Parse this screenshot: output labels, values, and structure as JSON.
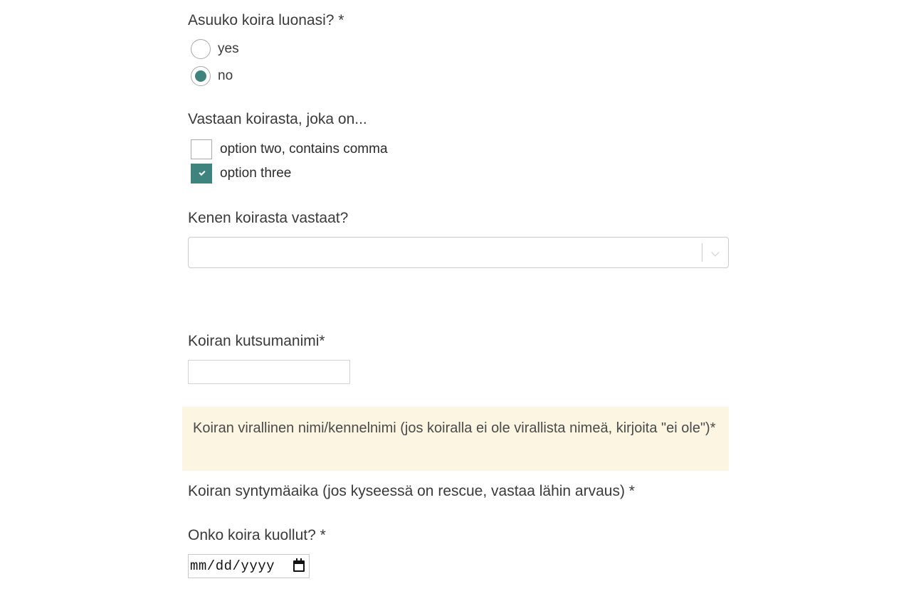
{
  "questions": {
    "lives_with": {
      "label": "Asuuko koira luonasi? *",
      "options": [
        {
          "label": "yes",
          "selected": false
        },
        {
          "label": "no",
          "selected": true
        }
      ]
    },
    "responsible_for": {
      "label": "Vastaan koirasta, joka on...",
      "options": [
        {
          "label": "option two, contains comma",
          "checked": false
        },
        {
          "label": "option three",
          "checked": true
        }
      ]
    },
    "whose_dog": {
      "label": "Kenen koirasta vastaat?",
      "value": ""
    },
    "call_name": {
      "label": "Koiran kutsumanimi*",
      "value": ""
    },
    "official_name": {
      "label": "Koiran virallinen nimi/kennelnimi (jos koiralla ei ole virallista nimeä, kirjoita \"ei ole\")*"
    },
    "birth_date": {
      "label": "Koiran syntymäaika (jos kyseessä on rescue, vastaa lähin arvaus) *"
    },
    "deceased": {
      "label": "Onko koira kuollut? *",
      "date_placeholder": "mm/dd/yyyy"
    }
  },
  "colors": {
    "accent": "#3f837f",
    "notice_bg": "#fbf5e2"
  },
  "icons": {
    "select_chevron": "chevron-down-icon",
    "date_picker": "calendar-icon",
    "checkmark": "checkmark-icon"
  }
}
